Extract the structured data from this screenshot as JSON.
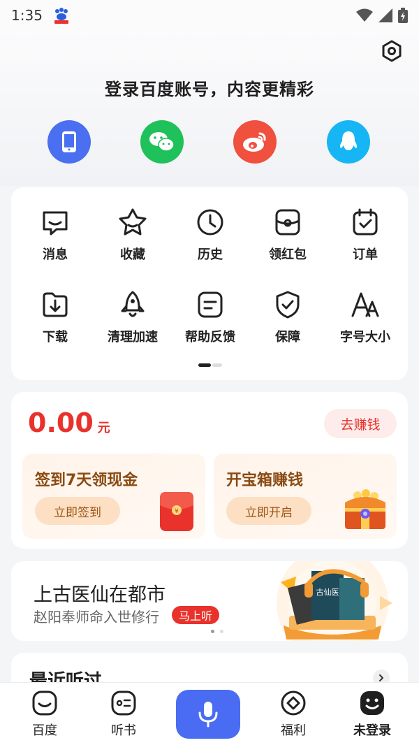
{
  "status_bar": {
    "time": "1:35"
  },
  "header": {
    "login_prompt": "登录百度账号，内容更精彩",
    "login_methods": [
      {
        "icon": "phone-icon",
        "color": "#4a6ff0"
      },
      {
        "icon": "wechat-icon",
        "color": "#1fc15a"
      },
      {
        "icon": "weibo-icon",
        "color": "#f0503e"
      },
      {
        "icon": "qq-icon",
        "color": "#16b6f4"
      }
    ]
  },
  "menu": {
    "items": [
      {
        "label": "消息",
        "icon": "message-icon"
      },
      {
        "label": "收藏",
        "icon": "star-icon"
      },
      {
        "label": "历史",
        "icon": "clock-icon"
      },
      {
        "label": "领红包",
        "icon": "red-packet-icon"
      },
      {
        "label": "订单",
        "icon": "order-icon"
      },
      {
        "label": "下载",
        "icon": "download-icon"
      },
      {
        "label": "清理加速",
        "icon": "rocket-icon"
      },
      {
        "label": "帮助反馈",
        "icon": "feedback-icon"
      },
      {
        "label": "保障",
        "icon": "shield-icon"
      },
      {
        "label": "字号大小",
        "icon": "font-size-icon"
      }
    ]
  },
  "earn": {
    "balance": "0.00",
    "unit": "元",
    "earn_label": "去赚钱",
    "tasks": [
      {
        "title": "签到7天领现金",
        "button": "立即签到",
        "icon": "red-envelope-icon"
      },
      {
        "title": "开宝箱赚钱",
        "button": "立即开启",
        "icon": "treasure-chest-icon"
      }
    ]
  },
  "book": {
    "title": "上古医仙在都市",
    "subtitle": "赵阳奉师命入世修行",
    "badge": "马上听"
  },
  "recent": {
    "title": "最近听过"
  },
  "tabs": [
    {
      "label": "百度",
      "icon": "baidu-home-icon"
    },
    {
      "label": "听书",
      "icon": "audiobook-icon"
    },
    {
      "label": "福利",
      "icon": "welfare-icon"
    },
    {
      "label": "未登录",
      "icon": "profile-icon"
    }
  ],
  "colors": {
    "accent": "#e8322b",
    "primary": "#4a6cf2"
  }
}
